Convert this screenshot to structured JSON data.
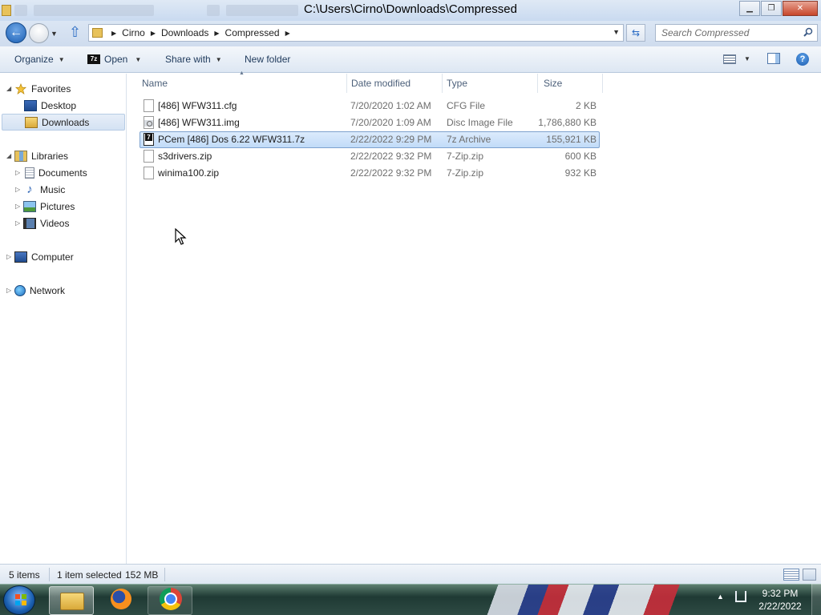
{
  "window": {
    "title": "C:\\Users\\Cirno\\Downloads\\Compressed",
    "minimize_label": "▁",
    "maximize_label": "❐",
    "close_label": "✕"
  },
  "address": {
    "crumbs": [
      "Cirno",
      "Downloads",
      "Compressed"
    ],
    "search_placeholder": "Search Compressed"
  },
  "toolbar": {
    "organize": "Organize",
    "open": "Open",
    "open_icon_text": "7z",
    "share_with": "Share with",
    "new_folder": "New folder"
  },
  "nav": {
    "favorites": "Favorites",
    "desktop": "Desktop",
    "downloads": "Downloads",
    "libraries": "Libraries",
    "documents": "Documents",
    "music": "Music",
    "pictures": "Pictures",
    "videos": "Videos",
    "computer": "Computer",
    "network": "Network"
  },
  "columns": {
    "name": "Name",
    "date": "Date modified",
    "type": "Type",
    "size": "Size"
  },
  "files": [
    {
      "name": "[486] WFW311.cfg",
      "date": "7/20/2020 1:02 AM",
      "type": "CFG File",
      "size": "2 KB",
      "icon": "generic-file-icon"
    },
    {
      "name": "[486] WFW311.img",
      "date": "7/20/2020 1:09 AM",
      "type": "Disc Image File",
      "size": "1,786,880 KB",
      "icon": "disc-image-icon"
    },
    {
      "name": "PCem [486] Dos 6.22 WFW311.7z",
      "date": "2/22/2022 9:29 PM",
      "type": "7z Archive",
      "size": "155,921 KB",
      "icon": "7z-archive-icon",
      "selected": true
    },
    {
      "name": "s3drivers.zip",
      "date": "2/22/2022 9:32 PM",
      "type": "7-Zip.zip",
      "size": "600 KB",
      "icon": "generic-file-icon"
    },
    {
      "name": "winima100.zip",
      "date": "2/22/2022 9:32 PM",
      "type": "7-Zip.zip",
      "size": "932 KB",
      "icon": "generic-file-icon"
    }
  ],
  "status": {
    "item_count": "5 items",
    "selection": "1 item selected",
    "selection_size": "152 MB"
  },
  "taskbar": {
    "time": "9:32 PM",
    "date": "2/22/2022"
  },
  "colors": {
    "selection_fill": "#c1dbf8",
    "selection_border": "#7da2ce",
    "accent": "#1e395b"
  }
}
